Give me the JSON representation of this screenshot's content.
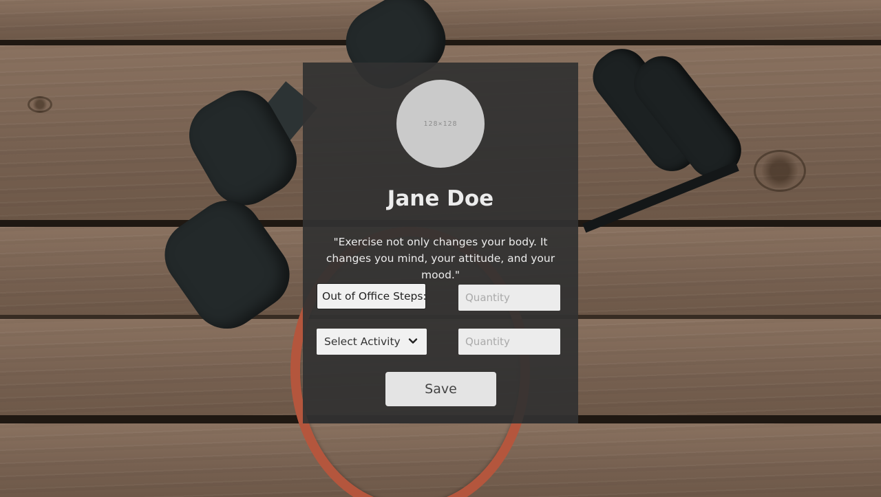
{
  "profile": {
    "avatar_placeholder": "128×128",
    "name": "Jane Doe",
    "quote": "\"Exercise not only changes your body. It changes you mind, your attitude, and your mood.\""
  },
  "form": {
    "steps_label": "Out of Office Steps:",
    "steps_quantity_placeholder": "Quantity",
    "activity_select_value": "Select Activity",
    "activity_quantity_placeholder": "Quantity",
    "save_label": "Save"
  },
  "icons": {
    "select_chevron": "chevron-down-icon"
  },
  "colors": {
    "card_background": "#323232",
    "avatar": "#cacaca",
    "button": "#e4e4e4",
    "band": "#b4563d"
  }
}
